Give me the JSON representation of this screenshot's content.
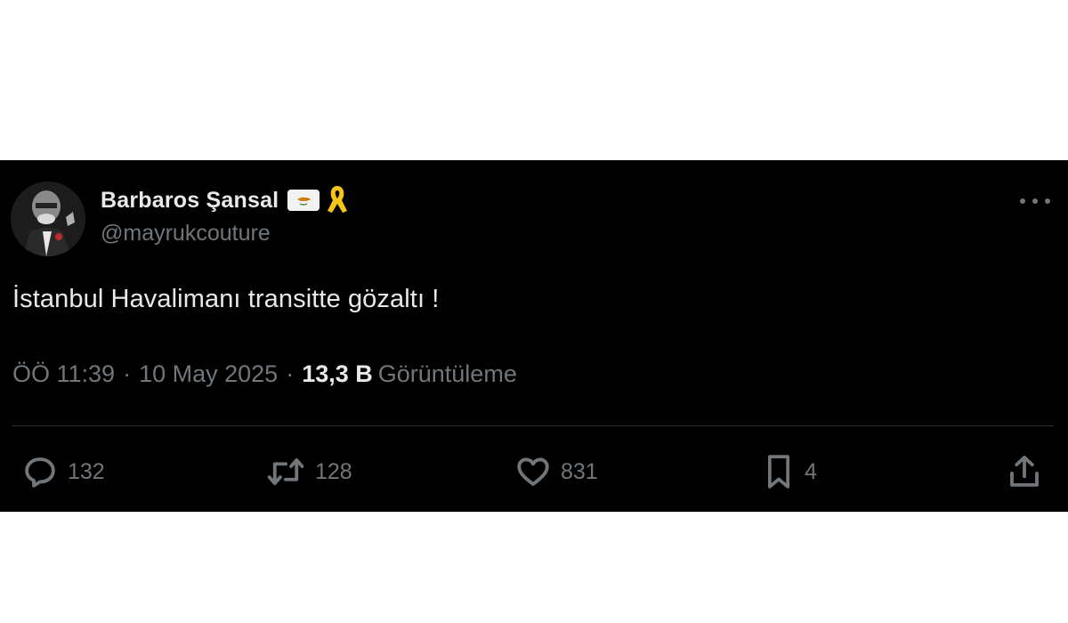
{
  "user": {
    "display_name": "Barbaros Şansal",
    "handle": "@mayrukcouture",
    "badge_icon": "cyprus-flag-icon",
    "ribbon_icon": "yellow-ribbon-icon"
  },
  "tweet": {
    "text": "İstanbul Havalimanı transitte gözaltı !",
    "time": "ÖÖ 11:39",
    "separator": "·",
    "date": "10 May 2025",
    "views_count": "13,3 B",
    "views_label": "Görüntüleme"
  },
  "actions": {
    "reply_count": "132",
    "retweet_count": "128",
    "like_count": "831",
    "bookmark_count": "4"
  },
  "colors": {
    "background": "#000000",
    "text": "#e7e9ea",
    "muted": "#71767b",
    "ribbon": "#f5c518"
  }
}
